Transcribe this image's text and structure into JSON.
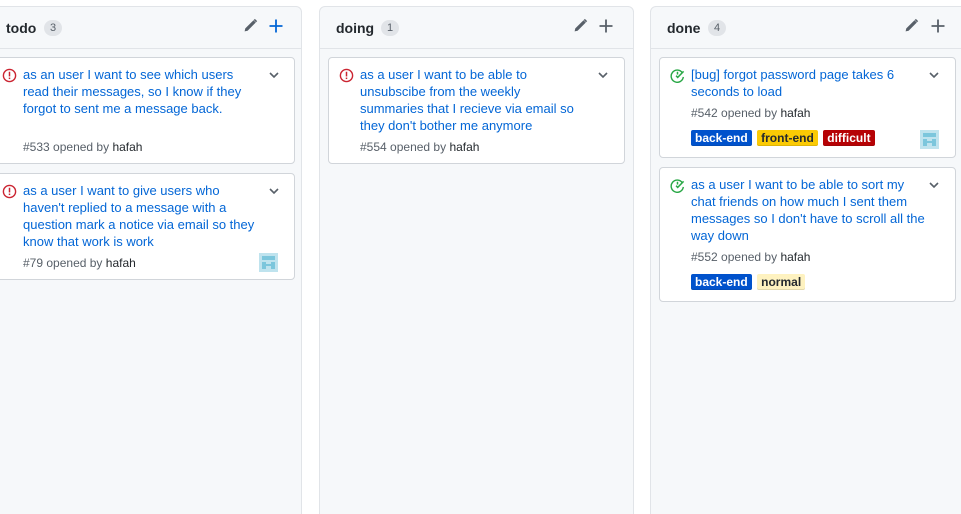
{
  "columns": [
    {
      "title": "todo",
      "count": "3",
      "cards": [
        {
          "title": "as an user I want to see which users read their messages, so I know if they forgot to sent me a message back.",
          "number": "#533",
          "opened_by_text": "opened by",
          "author": "hafah",
          "state": "open",
          "labels": [],
          "has_avatar": false
        },
        {
          "title": "as a user I want to give users who haven't replied to a message with a question mark a notice via email so they know that work is work",
          "number": "#79",
          "opened_by_text": "opened by",
          "author": "hafah",
          "state": "open",
          "labels": [],
          "has_avatar": true
        }
      ]
    },
    {
      "title": "doing",
      "count": "1",
      "cards": [
        {
          "title": "as a user I want to be able to unsubscibe from the weekly summaries that I recieve via email so they don't bother me anymore",
          "number": "#554",
          "opened_by_text": "opened by",
          "author": "hafah",
          "state": "open",
          "labels": [],
          "has_avatar": false
        }
      ]
    },
    {
      "title": "done",
      "count": "4",
      "cards": [
        {
          "title": "[bug] forgot password page takes 6 seconds to load",
          "number": "#542",
          "opened_by_text": "opened by",
          "author": "hafah",
          "state": "closed",
          "labels": [
            {
              "name": "back-end",
              "bg": "#0052cc",
              "fg": "#ffffff"
            },
            {
              "name": "front-end",
              "bg": "#fbca04",
              "fg": "#24292e"
            },
            {
              "name": "difficult",
              "bg": "#b60205",
              "fg": "#ffffff"
            }
          ],
          "has_avatar": true
        },
        {
          "title": "as a user I want to be able to sort my chat friends on how much I sent them messages so I don't have to scroll all the way down",
          "number": "#552",
          "opened_by_text": "opened by",
          "author": "hafah",
          "state": "closed",
          "labels": [
            {
              "name": "back-end",
              "bg": "#0052cc",
              "fg": "#ffffff"
            },
            {
              "name": "normal",
              "bg": "#fef2c0",
              "fg": "#24292e"
            }
          ],
          "has_avatar": false
        }
      ]
    }
  ],
  "colors": {
    "open_issue": "#cb2431",
    "closed_issue": "#28a745",
    "link": "#0366d6",
    "add_icon": "#0366d6"
  },
  "icons": {
    "column_edit": "pencil-icon",
    "column_add": "plus-icon",
    "card_menu": "chevron-down-icon",
    "open_state": "issue-opened-icon",
    "closed_state": "issue-closed-icon"
  }
}
